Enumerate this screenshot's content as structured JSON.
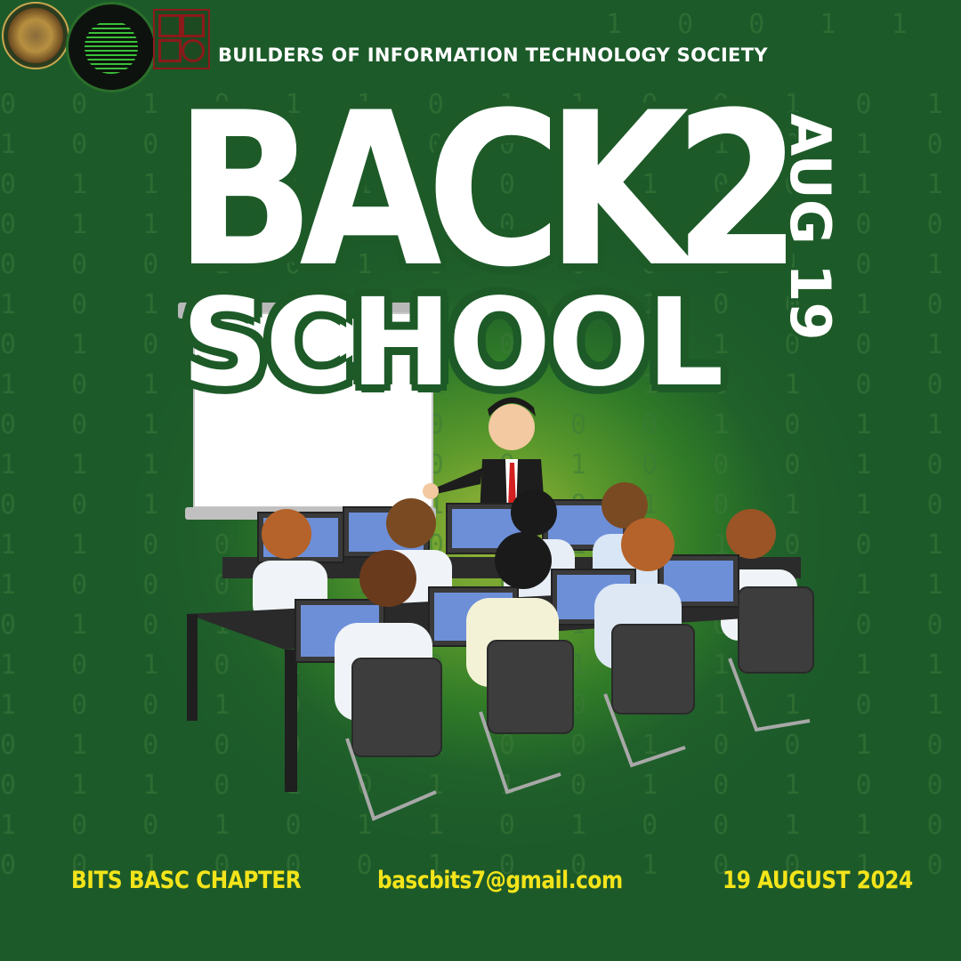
{
  "header": {
    "org_name": "BUILDERS OF INFORMATION TECHNOLOGY SOCIETY"
  },
  "headline": {
    "line1": "BACK2",
    "line2": "SCHOOL",
    "vertical_date": "AUG 19"
  },
  "footer": {
    "chapter": "BITS BASC CHAPTER",
    "email": "bascbits7@gmail.com",
    "date": "19 AUGUST 2024"
  },
  "colors": {
    "background": "#1f5d2a",
    "headline_fill": "#ffffff",
    "headline_outline": "#1d5a28",
    "footer_text": "#f3e41a"
  },
  "icons": [
    "college-seal-logo",
    "bits-logo",
    "grid-square-logo",
    "classroom-illustration"
  ]
}
